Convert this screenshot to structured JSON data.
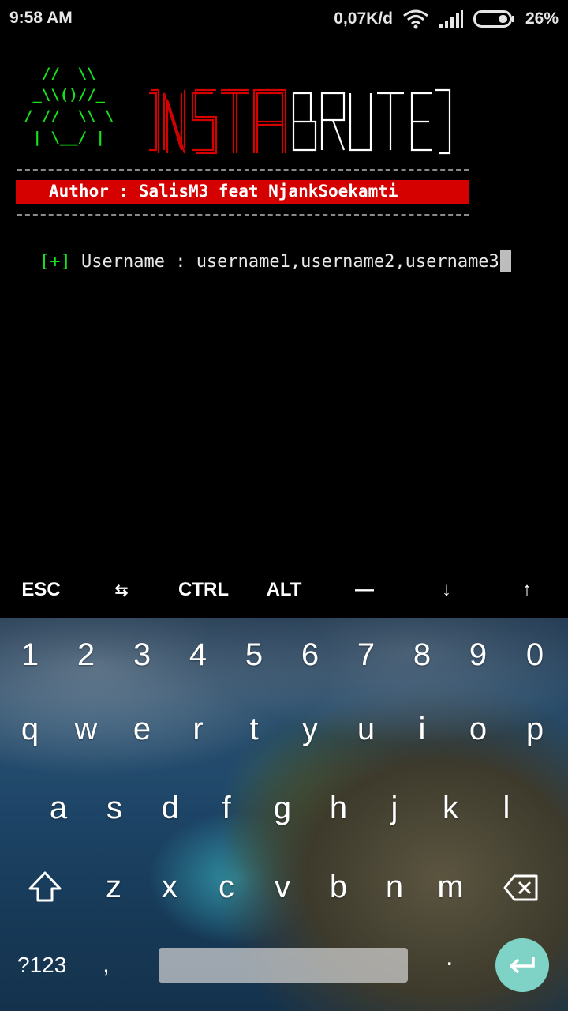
{
  "status_bar": {
    "time": "9:58 AM",
    "net_speed": "0,07K/d",
    "battery": "26%",
    "icons": [
      "wifi-icon",
      "signal-icon",
      "battery-icon"
    ]
  },
  "terminal": {
    "ascii_art": "  //  \\\\\n _\\\\()//_\n/ //  \\\\ \\\n | \\__/ |",
    "logo_text": "INSTABRUTE",
    "author_line": "Author : SalisM3 feat NjankSoekamti",
    "prompt_marker": "[+]",
    "prompt_text": " Username : username1,username2,username3",
    "colors": {
      "green": "#16e21b",
      "red": "#d50000"
    }
  },
  "extra_keys": [
    "ESC",
    "⇆",
    "CTRL",
    "ALT",
    "—",
    "↓",
    "↑"
  ],
  "keyboard": {
    "numbers": [
      "1",
      "2",
      "3",
      "4",
      "5",
      "6",
      "7",
      "8",
      "9",
      "0"
    ],
    "row1": [
      "q",
      "w",
      "e",
      "r",
      "t",
      "y",
      "u",
      "i",
      "o",
      "p"
    ],
    "row2": [
      "a",
      "s",
      "d",
      "f",
      "g",
      "h",
      "j",
      "k",
      "l"
    ],
    "row3": [
      "z",
      "x",
      "c",
      "v",
      "b",
      "n",
      "m"
    ],
    "symbols_label": "?123",
    "comma": ",",
    "period": ".",
    "accent_color": "#7fd3c6"
  }
}
